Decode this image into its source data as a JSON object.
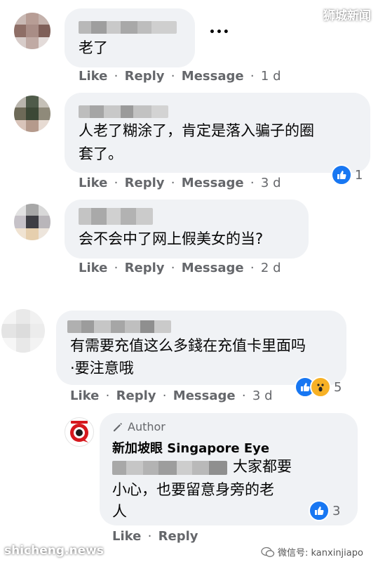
{
  "watermark": {
    "top_right": "狮城新闻",
    "bottom_left": "shicheng.news",
    "bottom_right": "微信号: kanxinjiapo"
  },
  "actions": {
    "like": "Like",
    "reply": "Reply",
    "message": "Message",
    "sep": "·"
  },
  "comments": [
    {
      "text": "老了",
      "time": "1 d",
      "more": "•••"
    },
    {
      "text_line1": "人老了糊涂了，肯定是落入骗子的圈",
      "text_line2": "套了。",
      "time": "3 d",
      "reaction_count": "1"
    },
    {
      "text": "会不会中了网上假美女的当?",
      "time": "2 d"
    },
    {
      "text_line1": "有需要充值这么多錢在充值卡里面吗",
      "text_line2": "·要注意哦",
      "time": "3 d",
      "reaction_count": "5"
    }
  ],
  "reply": {
    "badge": "Author",
    "author_name": "新加坡眼 Singapore Eye",
    "text_line1": "大家都要",
    "text_line2": "小心，也要留意身旁的老",
    "text_line3": "人",
    "reaction_count": "3"
  },
  "colors": {
    "bubble": "#f0f2f5",
    "meta": "#65676b",
    "like_blue": "#1877f2",
    "wow_yellow": "#f7b125",
    "brand_red": "#d6181e"
  }
}
